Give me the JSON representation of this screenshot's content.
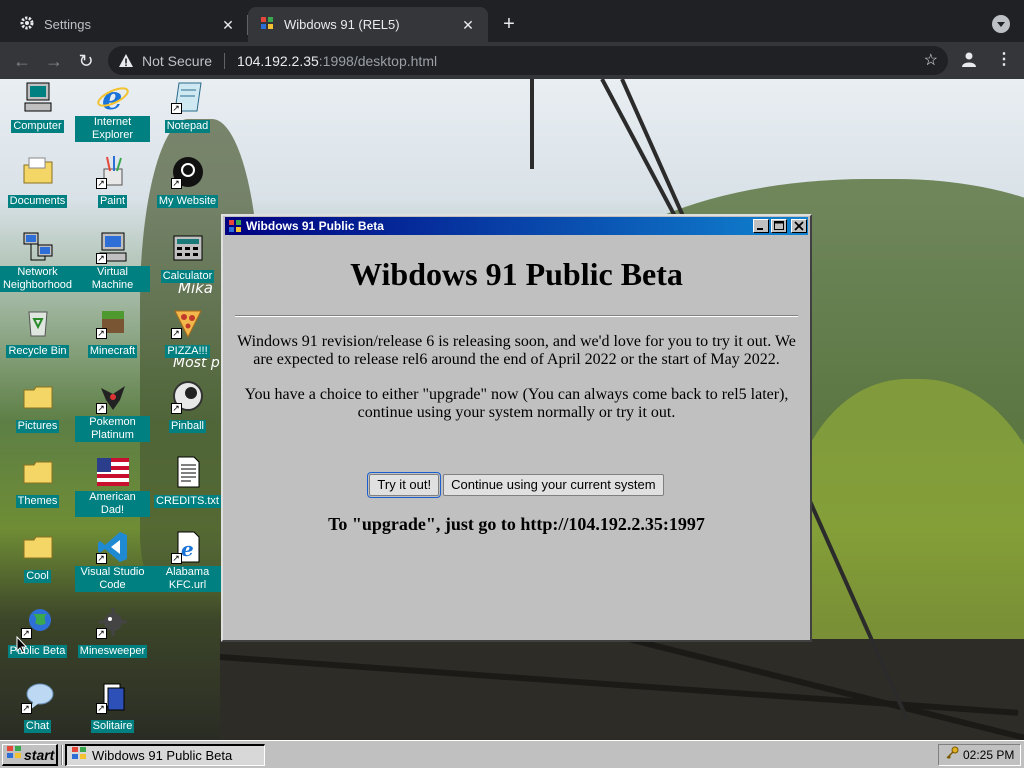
{
  "browser": {
    "tabs": [
      {
        "title": "Settings",
        "icon": "gear-icon",
        "active": false
      },
      {
        "title": "Wibdows 91 (REL5)",
        "icon": "windows-logo-icon",
        "active": true
      }
    ],
    "address": {
      "security_label": "Not Secure",
      "host": "104.192.2.35",
      "path": ":1998/desktop.html"
    }
  },
  "desktop": {
    "icons": [
      {
        "label": "Computer",
        "icon": "computer-icon",
        "shortcut": false
      },
      {
        "label": "Internet Explorer",
        "icon": "internet-explorer-icon",
        "shortcut": false
      },
      {
        "label": "Notepad",
        "icon": "notepad-icon",
        "shortcut": false
      },
      {
        "label": "Documents",
        "icon": "documents-folder-icon",
        "shortcut": false
      },
      {
        "label": "Paint",
        "icon": "paint-icon",
        "shortcut": true
      },
      {
        "label": "My Website",
        "icon": "github-icon",
        "shortcut": true
      },
      {
        "label": "Network Neighborhood",
        "icon": "network-icon",
        "shortcut": false
      },
      {
        "label": "Virtual Machine",
        "icon": "virtual-machine-icon",
        "shortcut": true
      },
      {
        "label": "Calculator",
        "icon": "calculator-icon",
        "shortcut": false
      },
      {
        "label": "Recycle Bin",
        "icon": "recycle-bin-icon",
        "shortcut": false
      },
      {
        "label": "Minecraft",
        "icon": "minecraft-icon",
        "shortcut": true
      },
      {
        "label": "PIZZA!!!",
        "icon": "pizza-icon",
        "shortcut": true
      },
      {
        "label": "Pictures",
        "icon": "pictures-folder-icon",
        "shortcut": false
      },
      {
        "label": "Pokemon Platinum",
        "icon": "pokemon-icon",
        "shortcut": true
      },
      {
        "label": "Pinball",
        "icon": "pinball-icon",
        "shortcut": true
      },
      {
        "label": "Themes",
        "icon": "themes-folder-icon",
        "shortcut": false
      },
      {
        "label": "American Dad!",
        "icon": "american-flag-icon",
        "shortcut": false
      },
      {
        "label": "CREDITS.txt",
        "icon": "text-file-icon",
        "shortcut": false
      },
      {
        "label": "Cool",
        "icon": "cool-folder-icon",
        "shortcut": false
      },
      {
        "label": "Visual Studio Code",
        "icon": "vscode-icon",
        "shortcut": true
      },
      {
        "label": "Alabama KFC.url",
        "icon": "internet-shortcut-icon",
        "shortcut": true
      },
      {
        "label": "Public Beta",
        "icon": "globe-icon",
        "shortcut": true
      },
      {
        "label": "Minesweeper",
        "icon": "minesweeper-icon",
        "shortcut": true
      },
      {
        "label": "Chat",
        "icon": "chat-bubble-icon",
        "shortcut": true
      },
      {
        "label": "Solitaire",
        "icon": "solitaire-icon",
        "shortcut": true
      }
    ],
    "wallpaper_text": [
      "Mika",
      "Most p"
    ]
  },
  "window": {
    "title": "Wibdows 91 Public Beta",
    "heading": "Wibdows 91 Public Beta",
    "paragraph1": "Windows 91 revision/release 6 is releasing soon, and we'd love for you to try it out. We are expected to release rel6 around the end of April 2022 or the start of May 2022.",
    "paragraph2": "You have a choice to either \"upgrade\" now (You can always come back to rel5 later), continue using your system normally or try it out.",
    "try_button": "Try it out!",
    "continue_button": "Continue using your current system",
    "upgrade_text": "To \"upgrade\", just go to http://104.192.2.35:1997"
  },
  "taskbar": {
    "start_label": "start",
    "task_label": "Wibdows 91 Public Beta",
    "clock": "02:25 PM"
  },
  "colors": {
    "desktop_label_bg": "#008080",
    "titlebar_start": "#000080",
    "titlebar_end": "#1084d0",
    "window_face": "#c0c0c0"
  }
}
